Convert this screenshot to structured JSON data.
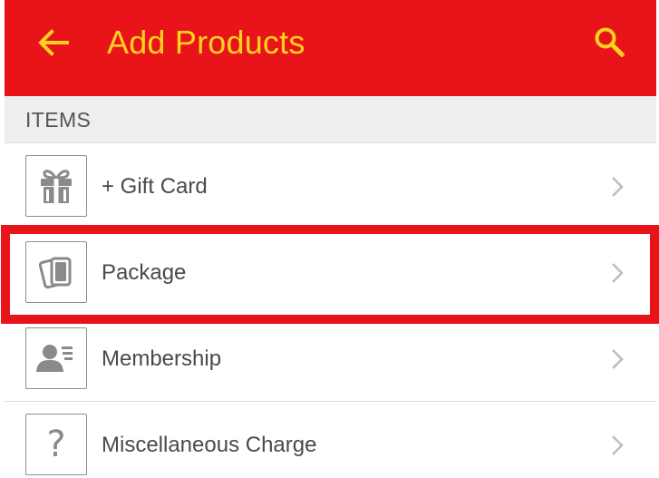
{
  "appbar": {
    "title": "Add Products",
    "back_icon": "arrow-left-icon",
    "search_icon": "search-icon",
    "background_color": "#e8141a",
    "foreground_color": "#ffd21e"
  },
  "section": {
    "header": "ITEMS"
  },
  "items": [
    {
      "label": "+ Gift Card",
      "icon": "gift-icon"
    },
    {
      "label": "Package",
      "icon": "cards-stack-icon",
      "highlighted": true
    },
    {
      "label": "Membership",
      "icon": "member-card-icon"
    },
    {
      "label": "Miscellaneous Charge",
      "icon": "question-mark-icon",
      "glyph": "?"
    }
  ],
  "colors": {
    "highlight_border": "#e8141a",
    "icon_gray": "#8a8a8a",
    "text": "#4a4a4a"
  }
}
